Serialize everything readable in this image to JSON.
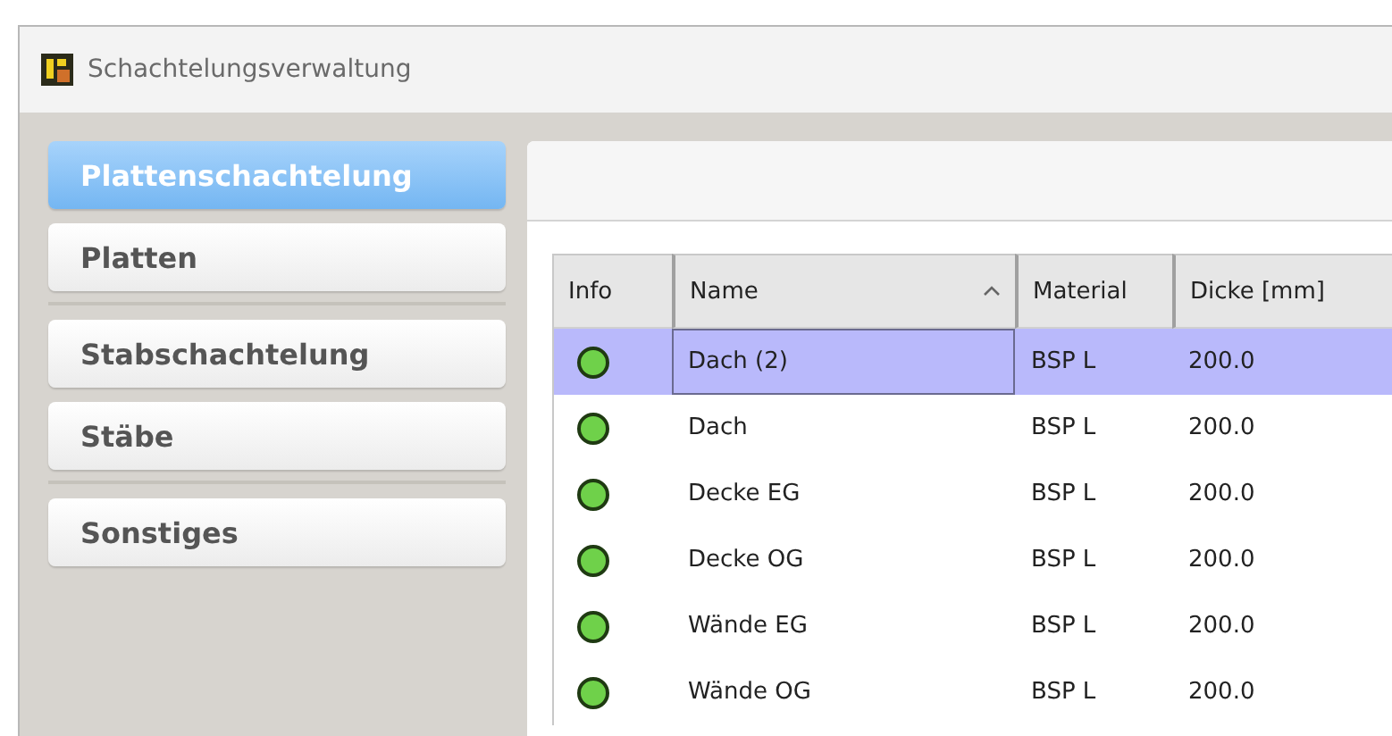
{
  "window": {
    "title": "Schachtelungsverwaltung"
  },
  "sidebar": {
    "groups": [
      {
        "items": [
          {
            "label": "Plattenschachtelung",
            "selected": true
          },
          {
            "label": "Platten",
            "selected": false
          }
        ]
      },
      {
        "items": [
          {
            "label": "Stabschachtelung",
            "selected": false
          },
          {
            "label": "Stäbe",
            "selected": false
          }
        ]
      },
      {
        "items": [
          {
            "label": "Sonstiges",
            "selected": false
          }
        ]
      }
    ]
  },
  "table": {
    "columns": [
      {
        "label": "Info",
        "sorted": false
      },
      {
        "label": "Name",
        "sorted": true
      },
      {
        "label": "Material",
        "sorted": false
      },
      {
        "label": "Dicke [mm]",
        "sorted": false
      }
    ],
    "rows": [
      {
        "color": "#6fd14a",
        "name": "Dach (2)",
        "material": "BSP L",
        "thickness": "200.0",
        "selected": true
      },
      {
        "color": "#6fd14a",
        "name": "Dach",
        "material": "BSP L",
        "thickness": "200.0",
        "selected": false
      },
      {
        "color": "#6fd14a",
        "name": "Decke EG",
        "material": "BSP L",
        "thickness": "200.0",
        "selected": false
      },
      {
        "color": "#6fd14a",
        "name": "Decke OG",
        "material": "BSP L",
        "thickness": "200.0",
        "selected": false
      },
      {
        "color": "#6fd14a",
        "name": "Wände EG",
        "material": "BSP L",
        "thickness": "200.0",
        "selected": false
      },
      {
        "color": "#6fd14a",
        "name": "Wände OG",
        "material": "BSP L",
        "thickness": "200.0",
        "selected": false
      }
    ]
  }
}
